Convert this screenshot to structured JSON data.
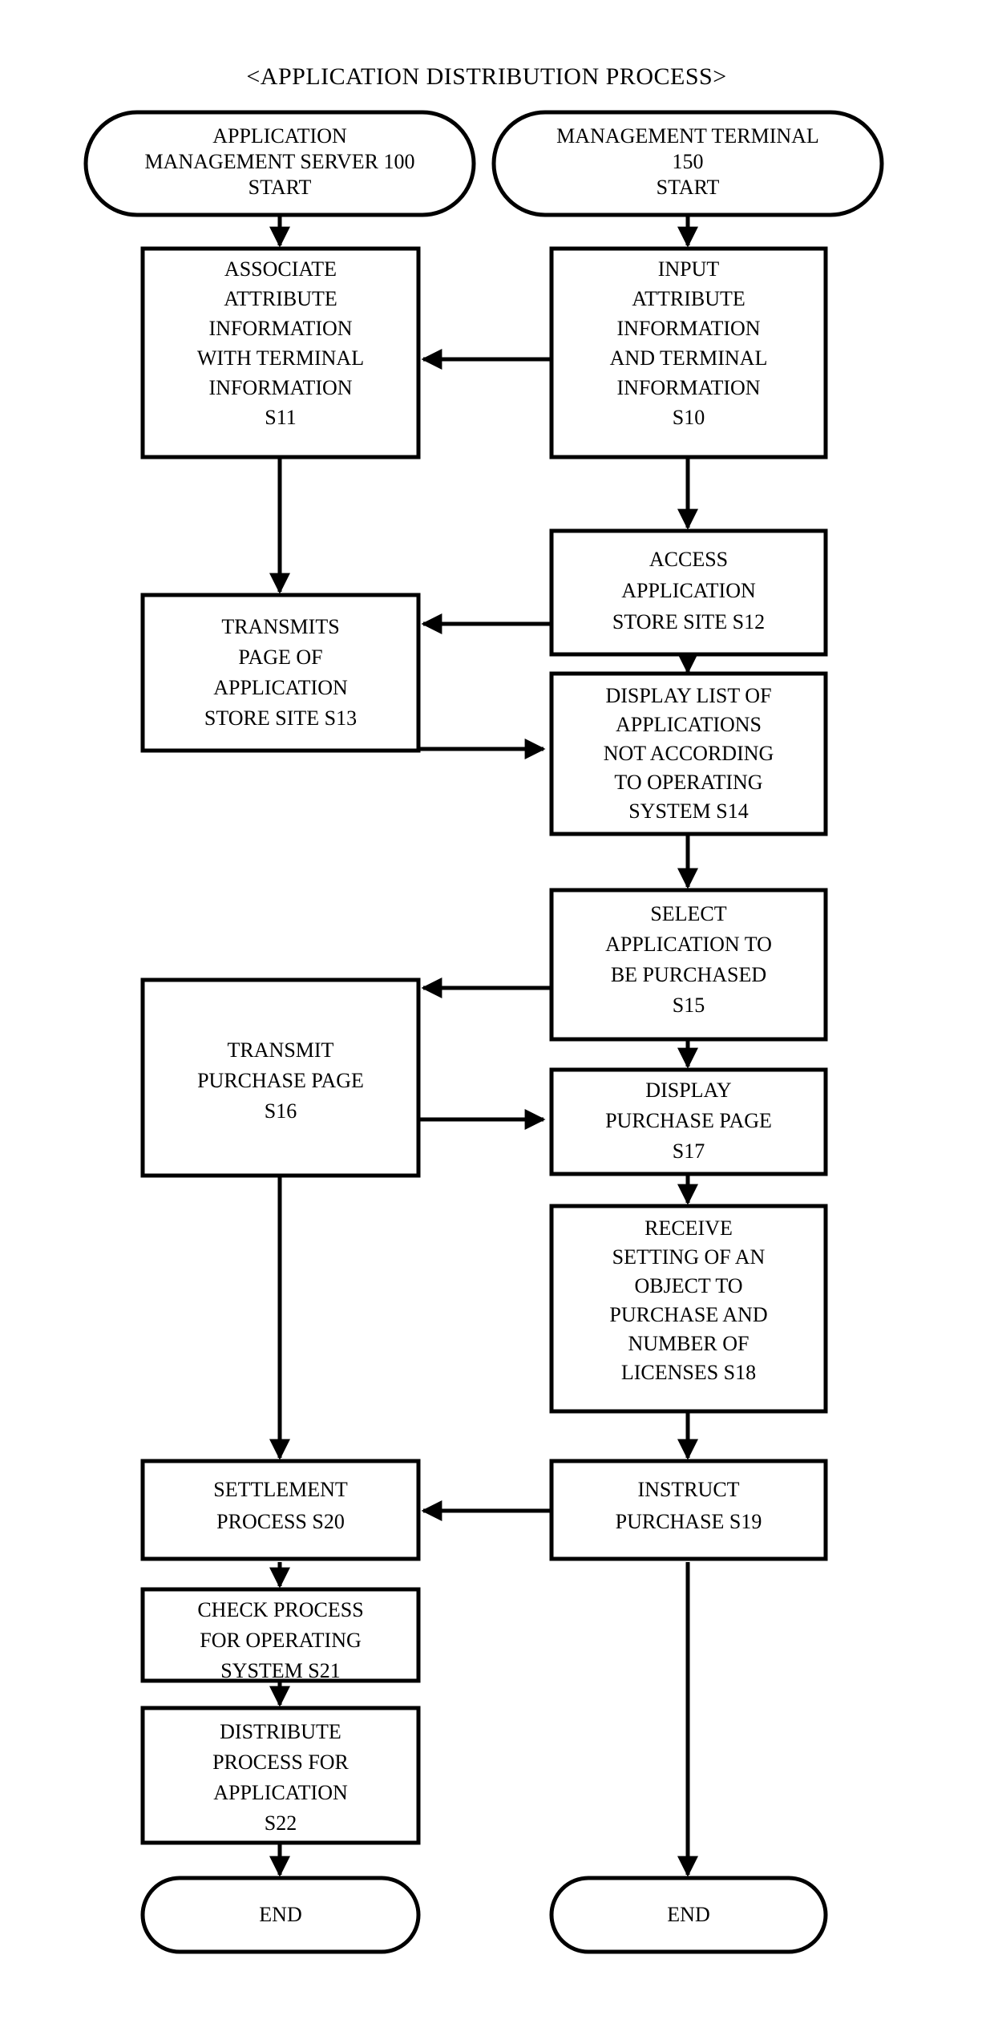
{
  "diagram": {
    "title": "<APPLICATION DISTRIBUTION PROCESS>",
    "columns": {
      "left": "APPLICATION MANAGEMENT SERVER 100",
      "right": "MANAGEMENT TERMINAL 150"
    },
    "nodes": [
      {
        "id": "start-left",
        "shape": "terminator",
        "lines": [
          "APPLICATION",
          "MANAGEMENT SERVER 100",
          "START"
        ]
      },
      {
        "id": "start-right",
        "shape": "terminator",
        "lines": [
          "MANAGEMENT TERMINAL",
          "150",
          "START"
        ]
      },
      {
        "id": "s11",
        "shape": "process",
        "step": "S11",
        "lines": [
          "ASSOCIATE",
          "ATTRIBUTE",
          "INFORMATION",
          "WITH TERMINAL",
          "INFORMATION",
          "S11"
        ]
      },
      {
        "id": "s10",
        "shape": "process",
        "step": "S10",
        "lines": [
          "INPUT",
          "ATTRIBUTE",
          "INFORMATION",
          "AND TERMINAL",
          "INFORMATION",
          "S10"
        ]
      },
      {
        "id": "s12",
        "shape": "process",
        "step": "S12",
        "lines": [
          "ACCESS",
          "APPLICATION",
          "STORE SITE S12"
        ]
      },
      {
        "id": "s13",
        "shape": "process",
        "step": "S13",
        "lines": [
          "TRANSMITS",
          "PAGE OF",
          "APPLICATION",
          "STORE SITE S13"
        ]
      },
      {
        "id": "s14",
        "shape": "process",
        "step": "S14",
        "lines": [
          "DISPLAY LIST OF",
          "APPLICATIONS",
          "NOT ACCORDING",
          "TO OPERATING",
          "SYSTEM S14"
        ]
      },
      {
        "id": "s15",
        "shape": "process",
        "step": "S15",
        "lines": [
          "SELECT",
          "APPLICATION TO",
          "BE PURCHASED",
          "S15"
        ]
      },
      {
        "id": "s16",
        "shape": "process",
        "step": "S16",
        "lines": [
          "TRANSMIT",
          "PURCHASE PAGE",
          "S16"
        ]
      },
      {
        "id": "s17",
        "shape": "process",
        "step": "S17",
        "lines": [
          "DISPLAY",
          "PURCHASE PAGE",
          "S17"
        ]
      },
      {
        "id": "s18",
        "shape": "process",
        "step": "S18",
        "lines": [
          "RECEIVE",
          "SETTING OF AN",
          "OBJECT TO",
          "PURCHASE AND",
          "NUMBER OF",
          "LICENSES S18"
        ]
      },
      {
        "id": "s19",
        "shape": "process",
        "step": "S19",
        "lines": [
          "INSTRUCT",
          "PURCHASE S19"
        ]
      },
      {
        "id": "s20",
        "shape": "process",
        "step": "S20",
        "lines": [
          "SETTLEMENT",
          "PROCESS S20"
        ]
      },
      {
        "id": "s21",
        "shape": "process",
        "step": "S21",
        "lines": [
          "CHECK PROCESS",
          "FOR OPERATING",
          "SYSTEM S21"
        ]
      },
      {
        "id": "s22",
        "shape": "process",
        "step": "S22",
        "lines": [
          "DISTRIBUTE",
          "PROCESS FOR",
          "APPLICATION",
          "S22"
        ]
      },
      {
        "id": "end-left",
        "shape": "terminator",
        "lines": [
          "END"
        ]
      },
      {
        "id": "end-right",
        "shape": "terminator",
        "lines": [
          "END"
        ]
      }
    ],
    "edges": [
      {
        "from": "start-left",
        "to": "s11",
        "direction": "down"
      },
      {
        "from": "start-right",
        "to": "s10",
        "direction": "down"
      },
      {
        "from": "s10",
        "to": "s11",
        "direction": "left"
      },
      {
        "from": "s10",
        "to": "s12",
        "direction": "down"
      },
      {
        "from": "s11",
        "to": "s13",
        "direction": "down"
      },
      {
        "from": "s12",
        "to": "s13",
        "direction": "left"
      },
      {
        "from": "s12",
        "to": "s14",
        "direction": "down"
      },
      {
        "from": "s13",
        "to": "s14",
        "direction": "right"
      },
      {
        "from": "s14",
        "to": "s15",
        "direction": "down"
      },
      {
        "from": "s15",
        "to": "s16",
        "direction": "left"
      },
      {
        "from": "s15",
        "to": "s17",
        "direction": "down"
      },
      {
        "from": "s16",
        "to": "s17",
        "direction": "right"
      },
      {
        "from": "s17",
        "to": "s18",
        "direction": "down"
      },
      {
        "from": "s18",
        "to": "s19",
        "direction": "down"
      },
      {
        "from": "s19",
        "to": "s20",
        "direction": "left"
      },
      {
        "from": "s19",
        "to": "end-right",
        "direction": "down"
      },
      {
        "from": "s16",
        "to": "s20",
        "direction": "down"
      },
      {
        "from": "s20",
        "to": "s21",
        "direction": "down"
      },
      {
        "from": "s21",
        "to": "s22",
        "direction": "down"
      },
      {
        "from": "s22",
        "to": "end-left",
        "direction": "down"
      }
    ],
    "colors": {
      "stroke": "#000000",
      "fill": "#ffffff",
      "text": "#000000"
    }
  }
}
